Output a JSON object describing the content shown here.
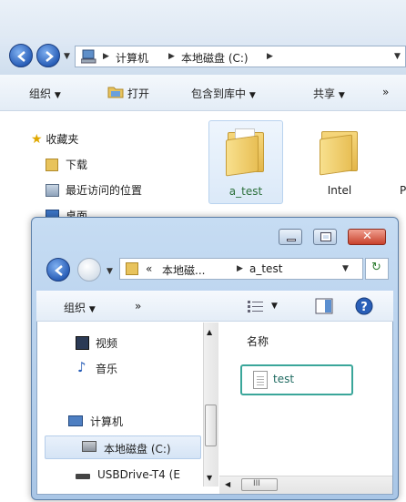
{
  "back_window": {
    "breadcrumb": [
      "计算机",
      "本地磁盘 (C:)"
    ],
    "toolbar": {
      "organize": "组织",
      "open": "打开",
      "include_in_library": "包含到库中",
      "share": "共享",
      "more": "»"
    },
    "nav": [
      {
        "label": "收藏夹",
        "icon": "star-icon"
      },
      {
        "label": "下载",
        "icon": "download-folder-icon"
      },
      {
        "label": "最近访问的位置",
        "icon": "recent-places-icon"
      },
      {
        "label": "桌面",
        "icon": "desktop-icon"
      }
    ],
    "folders": [
      {
        "label": "a_test",
        "selected": true
      },
      {
        "label": "Intel",
        "selected": false
      },
      {
        "label": "P",
        "selected": false
      }
    ]
  },
  "front_window": {
    "breadcrumb_prefix": "«",
    "breadcrumb": [
      "本地磁...",
      "a_test"
    ],
    "toolbar": {
      "organize": "组织",
      "more": "»"
    },
    "nav": [
      {
        "label": "视频",
        "icon": "video-library-icon"
      },
      {
        "label": "音乐",
        "icon": "music-library-icon"
      },
      {
        "label": "计算机",
        "icon": "computer-icon"
      },
      {
        "label": "本地磁盘 (C:)",
        "icon": "local-disk-icon",
        "selected": true
      },
      {
        "label": "USBDrive-T4 (E",
        "icon": "usb-drive-icon"
      }
    ],
    "column_header": "名称",
    "files": [
      {
        "label": "test",
        "icon": "text-file-icon"
      }
    ],
    "hscroll_label": "III"
  },
  "colors": {
    "highlight_box": "#3aa69a",
    "title_gradient_top": "#c6dcf3",
    "close_button": "#c8412c"
  }
}
